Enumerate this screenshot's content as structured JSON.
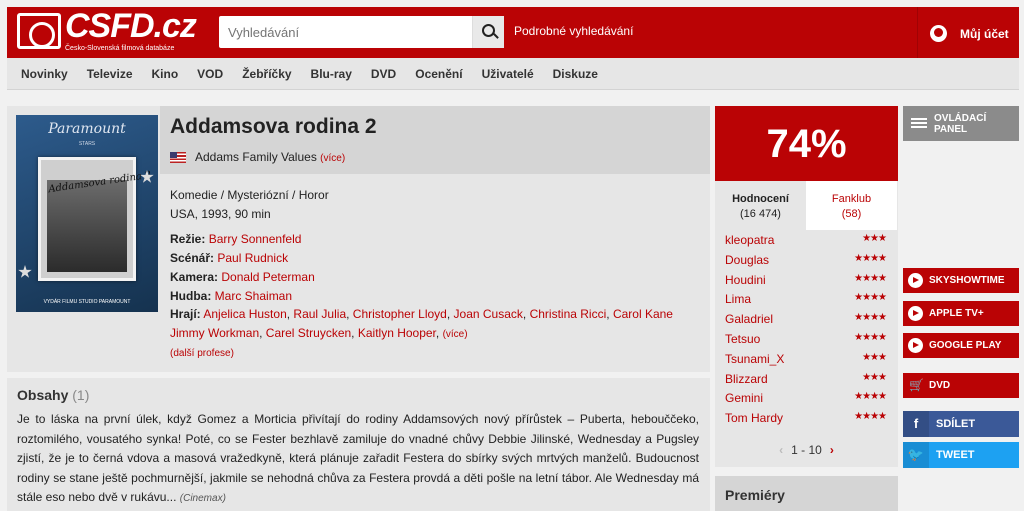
{
  "header": {
    "logo_text": "CSFD.cz",
    "logo_tagline": "Česko-Slovenská filmová databáze",
    "search_placeholder": "Vyhledávání",
    "advanced_search": "Podrobné vyhledávání",
    "account": "Můj účet"
  },
  "nav": [
    "Novinky",
    "Televize",
    "Kino",
    "VOD",
    "Žebříčky",
    "Blu-ray",
    "DVD",
    "Ocenění",
    "Uživatelé",
    "Diskuze"
  ],
  "film": {
    "title": "Addamsova rodina 2",
    "original_title": "Addams Family Values",
    "more": "(více)",
    "genres": "Komedie / Mysteriózní / Horor",
    "origin": "USA, 1993, 90 min",
    "directing_label": "Režie:",
    "director": "Barry Sonnenfeld",
    "script_label": "Scénář:",
    "writer": "Paul Rudnick",
    "camera_label": "Kamera:",
    "camera": "Donald Peterman",
    "music_label": "Hudba:",
    "music": "Marc Shaiman",
    "cast_label": "Hrají:",
    "cast": [
      "Anjelica Huston",
      "Raul Julia",
      "Christopher Lloyd",
      "Joan Cusack",
      "Christina Ricci",
      "Carol Kane",
      "Jimmy Workman",
      "Carel Struycken",
      "Kaitlyn Hooper"
    ],
    "cast_more": "(více)",
    "more_professions": "(další profese)",
    "poster": {
      "studio": "Paramount",
      "studio_sub": "STARS",
      "title": "Addamsova rodina 2",
      "footer": "VYDÁR FILMU STUDIO PARAMOUNT"
    }
  },
  "plot": {
    "heading": "Obsahy",
    "count": "(1)",
    "text": "Je to láska na první úlek, když Gomez a Morticia přivítají do rodiny Addamsových nový přírůstek – Puberta, hebouččeko, roztomilého, vousatého synka! Poté, co se Fester bezhlavě zamiluje do vnadné chůvy Debbie Jilinské, Wednesday a Pugsley zjistí, že je to černá vdova a masová vražedkyně, která plánuje zařadit Festera do sbírky svých mrtvých manželů. Budoucnost rodiny se stane ještě pochmurnější, jakmile se nehodná chůva za Festera provdá a děti pošle na letní tábor. Ale Wednesday má stále eso nebo dvě v rukávu...",
    "source": "(Cinemax)"
  },
  "rating": {
    "score": "74%",
    "tab_ratings": "Hodnocení",
    "tab_ratings_count": "(16 474)",
    "tab_fanclub": "Fanklub",
    "tab_fanclub_count": "(58)",
    "users": [
      {
        "name": "kleopatra",
        "stars": "★★★"
      },
      {
        "name": "Douglas",
        "stars": "★★★★"
      },
      {
        "name": "Houdini",
        "stars": "★★★★"
      },
      {
        "name": "Lima",
        "stars": "★★★★"
      },
      {
        "name": "Galadriel",
        "stars": "★★★★"
      },
      {
        "name": "Tetsuo",
        "stars": "★★★★"
      },
      {
        "name": "Tsunami_X",
        "stars": "★★★"
      },
      {
        "name": "Blizzard",
        "stars": "★★★"
      },
      {
        "name": "Gemini",
        "stars": "★★★★"
      },
      {
        "name": "Tom Hardy",
        "stars": "★★★★"
      }
    ],
    "pager": "1 - 10",
    "premieres": "Premiéry"
  },
  "side": {
    "panel": "OVLÁDACÍ PANEL",
    "vod": [
      "SKYSHOWTIME",
      "APPLE TV+",
      "GOOGLE PLAY"
    ],
    "dvd": "DVD",
    "share": "SDÍLET",
    "tweet": "TWEET",
    "colors": {
      "brand": "#ba0305",
      "facebook": "#3b5998",
      "twitter": "#1da1f2"
    }
  }
}
